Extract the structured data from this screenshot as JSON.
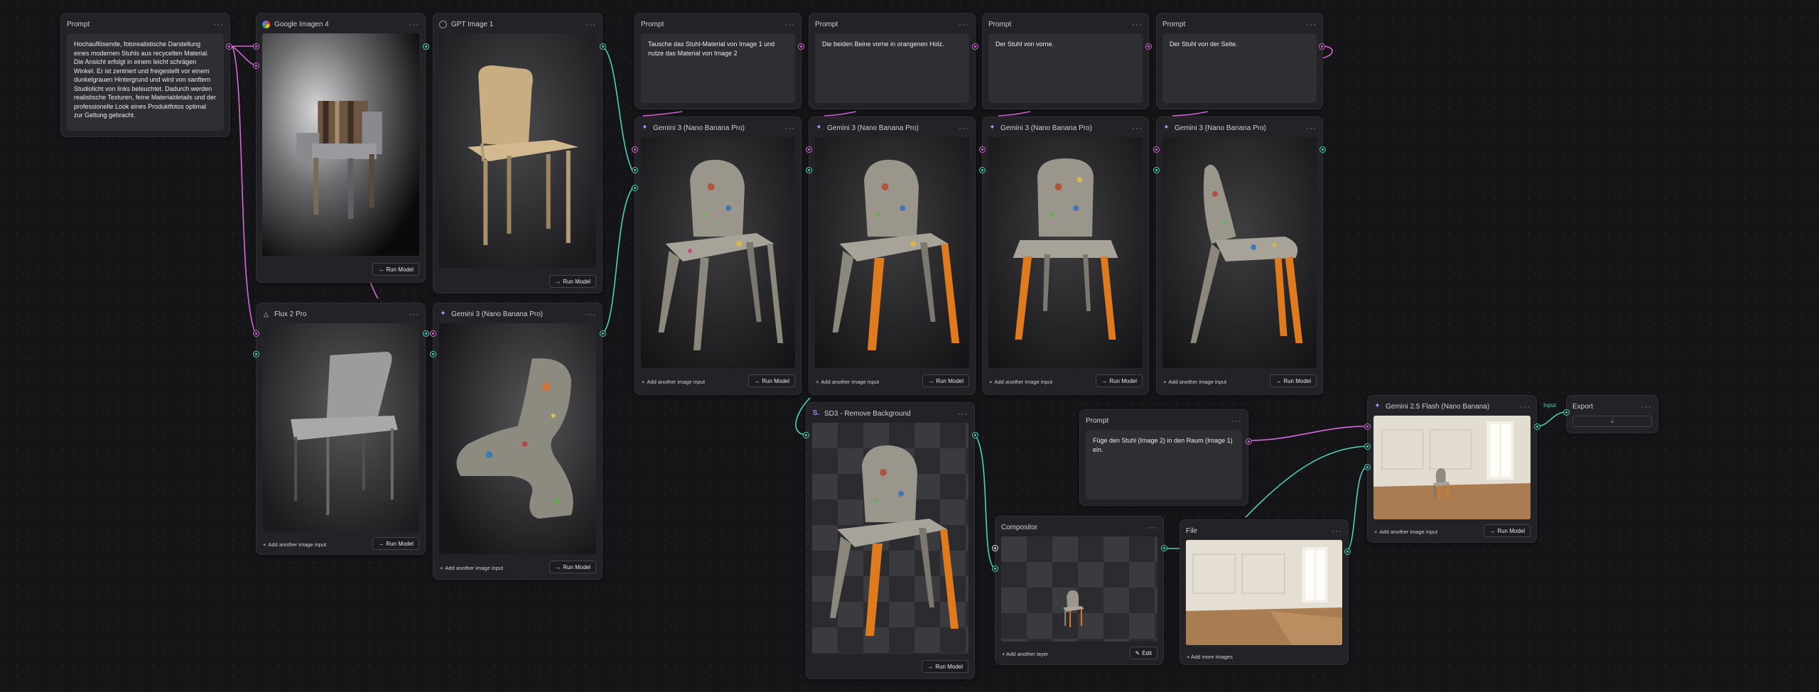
{
  "colors": {
    "prompt_port": "#d768d8",
    "image_port": "#4fd1b8",
    "canvas_bg": "#151518",
    "node_bg": "#232327"
  },
  "prompt_main": {
    "title": "Prompt",
    "text": "Hochauflösende, fotorealistische Darstellung eines modernen Stuhls aus recycelten Material. Die Ansicht erfolgt in einem leicht schrägen Winkel. Er ist zentriert und freigestellt vor einem dunkelgrauen Hintergrund und wird von sanftem Studiolicht von links beleuchtet. Dadurch werden realistische Texturen, feine Materialdetails und der professionelle Look eines Produktfotos optimal zur Geltung gebracht."
  },
  "imagen": {
    "title": "Google Imagen 4",
    "run": "Run Model",
    "icon": "google-icon"
  },
  "gpt": {
    "title": "GPT Image 1",
    "run": "Run Model",
    "icon": "openai-icon"
  },
  "flux": {
    "title": "Flux 2 Pro",
    "run": "Run Model",
    "add": "Add another image input",
    "icon": "flux-icon"
  },
  "gemini_b": {
    "title": "Gemini 3 (Nano Banana Pro)",
    "run": "Run Model",
    "add": "Add another image input"
  },
  "prompts_top": [
    {
      "title": "Prompt",
      "text": "Tausche das Stuhl-Material von Image 1 und nutze das Material von Image 2"
    },
    {
      "title": "Prompt",
      "text": "Die beiden Beine vorne in orangenen Holz."
    },
    {
      "title": "Prompt",
      "text": "Der Stuhl von vorne."
    },
    {
      "title": "Prompt",
      "text": "Der Stuhl von der Seite."
    }
  ],
  "gemini_row": [
    {
      "title": "Gemini 3 (Nano Banana Pro)",
      "run": "Run Model",
      "add": "Add another image input"
    },
    {
      "title": "Gemini 3 (Nano Banana Pro)",
      "run": "Run Model",
      "add": "Add another image input"
    },
    {
      "title": "Gemini 3 (Nano Banana Pro)",
      "run": "Run Model",
      "add": "Add another image input"
    },
    {
      "title": "Gemini 3 (Nano Banana Pro)",
      "run": "Run Model",
      "add": "Add another image input"
    }
  ],
  "sd3": {
    "title": "SD3 - Remove Background",
    "run": "Run Model"
  },
  "prompt_room": {
    "title": "Prompt",
    "text": "Füge den Stuhl (Image 2) in den Raum (Image 1) ein."
  },
  "compositor": {
    "title": "Compositor",
    "add": "+ Add another layer",
    "edit": "Edit"
  },
  "file": {
    "title": "File",
    "add": "+ Add more images"
  },
  "flash": {
    "title": "Gemini 2.5 Flash (Nano Banana)",
    "run": "Run Model",
    "add": "Add another image input"
  },
  "export": {
    "title": "Export",
    "input_label": "Input"
  }
}
